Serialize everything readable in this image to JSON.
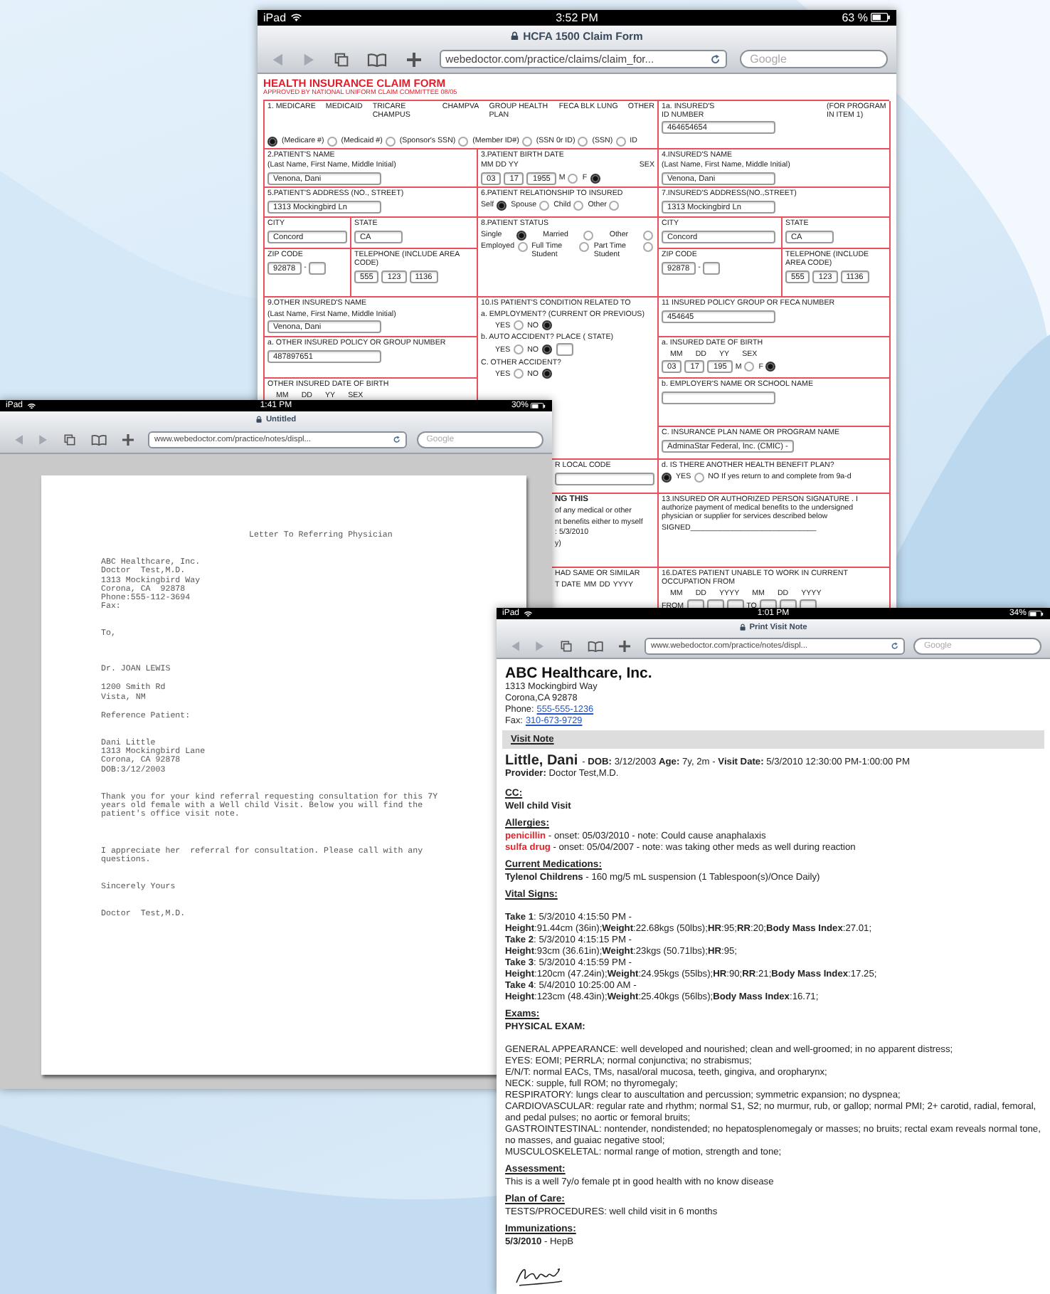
{
  "claim_window": {
    "status_bar": {
      "device": "iPad",
      "time": "3:52 PM",
      "battery": "63 %"
    },
    "title": "HCFA 1500 Claim Form",
    "url": "webedoctor.com/practice/claims/claim_for...",
    "search": {
      "placeholder": "Google"
    },
    "form": {
      "title": "HEALTH INSURANCE CLAIM FORM",
      "subtitle": "APPROVED BY NATIONAL UNIFORM CLAIM COMMITTEE 08/05",
      "cells": [
        {
          "lines": [
            {
              "kind": "spread",
              "parts": [
                {
                  "kind": "text",
                  "text": "1. MEDICARE"
                },
                {
                  "kind": "text",
                  "text": "MEDICAID"
                },
                {
                  "kind": "text",
                  "text": "TRICARE CHAMPUS"
                },
                {
                  "kind": "text",
                  "text": "CHAMPVA"
                },
                {
                  "kind": "text",
                  "text": "GROUP HEALTH PLAN"
                },
                {
                  "kind": "text",
                  "text": "FECA BLK LUNG"
                },
                {
                  "kind": "text",
                  "text": "OTHER"
                }
              ]
            },
            {
              "kind": "bottom",
              "parts": [
                {
                  "kind": "radio",
                  "selected": true
                },
                {
                  "kind": "text",
                  "text": "(Medicare #)"
                },
                {
                  "kind": "radio",
                  "selected": false
                },
                {
                  "kind": "text",
                  "text": "(Medicaid #)"
                },
                {
                  "kind": "radio",
                  "selected": false
                },
                {
                  "kind": "text",
                  "text": "(Sponsor's SSN)"
                },
                {
                  "kind": "radio",
                  "selected": false
                },
                {
                  "kind": "text",
                  "text": "(Member ID#)"
                },
                {
                  "kind": "radio",
                  "selected": false
                },
                {
                  "kind": "text",
                  "text": "(SSN 0r ID)"
                },
                {
                  "kind": "radio",
                  "selected": false
                },
                {
                  "kind": "text",
                  "text": "(SSN)"
                },
                {
                  "kind": "radio",
                  "selected": false
                },
                {
                  "kind": "text",
                  "text": "ID"
                }
              ]
            }
          ]
        },
        {
          "lines": [
            {
              "kind": "spread",
              "parts": [
                {
                  "kind": "text",
                  "text": "1a. INSURED'S ID NUMBER"
                },
                {
                  "kind": "text",
                  "text": "(FOR PROGRAM IN ITEM 1)"
                }
              ]
            },
            {
              "kind": "row",
              "parts": [
                {
                  "kind": "field",
                  "value": "464654654"
                }
              ]
            }
          ]
        },
        {
          "lines": [
            {
              "kind": "row",
              "parts": [
                {
                  "kind": "text",
                  "text": "2.PATIENT'S NAME"
                }
              ]
            },
            {
              "kind": "row",
              "parts": [
                {
                  "kind": "text",
                  "text": "(Last Name, First Name, Middle Initial)"
                }
              ]
            },
            {
              "kind": "row",
              "parts": [
                {
                  "kind": "field",
                  "value": "Venona, Dani"
                }
              ]
            }
          ]
        },
        {
          "lines": [
            {
              "kind": "row",
              "parts": [
                {
                  "kind": "text",
                  "text": "3.PATIENT BIRTH DATE"
                }
              ]
            },
            {
              "kind": "spread",
              "parts": [
                {
                  "kind": "text",
                  "text": "MM DD YY"
                },
                {
                  "kind": "text",
                  "text": "SEX"
                }
              ]
            },
            {
              "kind": "row",
              "parts": [
                {
                  "kind": "field",
                  "value": "03"
                },
                {
                  "kind": "field",
                  "value": "17"
                },
                {
                  "kind": "field",
                  "value": "1955"
                },
                {
                  "kind": "text",
                  "text": "M"
                },
                {
                  "kind": "radio",
                  "selected": false
                },
                {
                  "kind": "text",
                  "text": "F"
                },
                {
                  "kind": "radio",
                  "selected": true
                }
              ]
            }
          ]
        },
        {
          "lines": [
            {
              "kind": "row",
              "parts": [
                {
                  "kind": "text",
                  "text": "4.INSURED'S NAME"
                }
              ]
            },
            {
              "kind": "row",
              "parts": [
                {
                  "kind": "text",
                  "text": "(Last Name, First Name, Middle Initial)"
                }
              ]
            },
            {
              "kind": "row",
              "parts": [
                {
                  "kind": "field",
                  "value": "Venona, Dani"
                }
              ]
            }
          ]
        },
        {
          "lines": [
            {
              "kind": "row",
              "parts": [
                {
                  "kind": "text",
                  "text": "5.PATIENT'S ADDRESS (NO., STREET)"
                }
              ]
            },
            {
              "kind": "row",
              "parts": [
                {
                  "kind": "field",
                  "value": "1313 Mockingbird Ln"
                }
              ]
            }
          ]
        },
        {
          "lines": [
            {
              "kind": "row",
              "parts": [
                {
                  "kind": "text",
                  "text": "6.PATIENT RELATIONSHIP TO INSURED"
                }
              ]
            },
            {
              "kind": "row",
              "parts": [
                {
                  "kind": "text",
                  "text": "Self"
                },
                {
                  "kind": "radio",
                  "selected": true
                },
                {
                  "kind": "text",
                  "text": "Spouse"
                },
                {
                  "kind": "radio",
                  "selected": false
                },
                {
                  "kind": "text",
                  "text": "Child"
                },
                {
                  "kind": "radio",
                  "selected": false
                },
                {
                  "kind": "text",
                  "text": "Other"
                },
                {
                  "kind": "radio",
                  "selected": false
                }
              ]
            }
          ]
        },
        {
          "lines": [
            {
              "kind": "row",
              "parts": [
                {
                  "kind": "text",
                  "text": "7.INSURED'S ADDRESS(NO.,STREET)"
                }
              ]
            },
            {
              "kind": "row",
              "parts": [
                {
                  "kind": "field",
                  "value": "1313 Mockingbird Ln"
                }
              ]
            }
          ]
        },
        {
          "lines": [
            {
              "kind": "row",
              "parts": [
                {
                  "kind": "text",
                  "text": "CITY"
                }
              ]
            },
            {
              "kind": "row",
              "parts": [
                {
                  "kind": "field",
                  "value": "Concord"
                }
              ]
            }
          ]
        },
        {
          "lines": [
            {
              "kind": "row",
              "parts": [
                {
                  "kind": "text",
                  "text": "STATE"
                }
              ]
            },
            {
              "kind": "row",
              "parts": [
                {
                  "kind": "field",
                  "value": "CA"
                }
              ]
            }
          ]
        },
        {
          "lines": [
            {
              "kind": "row",
              "parts": [
                {
                  "kind": "text",
                  "text": "8.PATIENT STATUS"
                }
              ]
            },
            {
              "kind": "spread",
              "parts": [
                {
                  "kind": "text",
                  "text": "Single"
                },
                {
                  "kind": "radio",
                  "selected": true
                },
                {
                  "kind": "text",
                  "text": "Married"
                },
                {
                  "kind": "radio",
                  "selected": false
                },
                {
                  "kind": "text",
                  "text": "Other"
                },
                {
                  "kind": "radio",
                  "selected": false
                }
              ]
            },
            {
              "kind": "spread",
              "parts": [
                {
                  "kind": "text",
                  "text": "Employed"
                },
                {
                  "kind": "radio",
                  "selected": false
                },
                {
                  "kind": "text",
                  "text": "Full Time Student"
                },
                {
                  "kind": "radio",
                  "selected": false
                },
                {
                  "kind": "text",
                  "text": "Part Time Student"
                },
                {
                  "kind": "radio",
                  "selected": false
                }
              ]
            }
          ]
        },
        {
          "lines": [
            {
              "kind": "row",
              "parts": [
                {
                  "kind": "text",
                  "text": "CITY"
                }
              ]
            },
            {
              "kind": "row",
              "parts": [
                {
                  "kind": "field",
                  "value": "Concord"
                }
              ]
            }
          ]
        },
        {
          "lines": [
            {
              "kind": "row",
              "parts": [
                {
                  "kind": "text",
                  "text": "STATE"
                }
              ]
            },
            {
              "kind": "row",
              "parts": [
                {
                  "kind": "field",
                  "value": "CA"
                }
              ]
            }
          ]
        },
        {
          "lines": [
            {
              "kind": "row",
              "parts": [
                {
                  "kind": "text",
                  "text": "ZIP CODE"
                }
              ]
            },
            {
              "kind": "row",
              "parts": [
                {
                  "kind": "field",
                  "value": "92878"
                },
                {
                  "kind": "text",
                  "text": "-"
                },
                {
                  "kind": "field"
                }
              ]
            }
          ]
        },
        {
          "lines": [
            {
              "kind": "row",
              "parts": [
                {
                  "kind": "text",
                  "text": "TELEPHONE (INCLUDE AREA CODE)"
                }
              ]
            },
            {
              "kind": "row",
              "parts": [
                {
                  "kind": "field",
                  "value": "555"
                },
                {
                  "kind": "field",
                  "value": "123"
                },
                {
                  "kind": "field",
                  "value": "1136"
                }
              ]
            }
          ]
        },
        {
          "lines": [
            {
              "kind": "row",
              "parts": [
                {
                  "kind": "text",
                  "text": "ZIP CODE"
                }
              ]
            },
            {
              "kind": "row",
              "parts": [
                {
                  "kind": "field",
                  "value": "92878"
                },
                {
                  "kind": "text",
                  "text": "-"
                },
                {
                  "kind": "field"
                }
              ]
            }
          ]
        },
        {
          "lines": [
            {
              "kind": "row",
              "parts": [
                {
                  "kind": "text",
                  "text": "TELEPHONE (INCLUDE AREA CODE)"
                }
              ]
            },
            {
              "kind": "row",
              "parts": [
                {
                  "kind": "field",
                  "value": "555"
                },
                {
                  "kind": "field",
                  "value": "123"
                },
                {
                  "kind": "field",
                  "value": "1136"
                }
              ]
            }
          ]
        },
        {
          "lines": [
            {
              "kind": "row",
              "parts": [
                {
                  "kind": "text",
                  "text": "9.OTHER INSURED'S NAME"
                }
              ]
            },
            {
              "kind": "row",
              "parts": [
                {
                  "kind": "text",
                  "text": "(Last Name, First Name, Middle Initial)"
                }
              ]
            },
            {
              "kind": "row",
              "parts": [
                {
                  "kind": "field",
                  "value": "Venona, Dani"
                }
              ]
            }
          ]
        },
        {
          "lines": [
            {
              "kind": "row",
              "parts": [
                {
                  "kind": "text",
                  "text": "10.IS PATIENT'S CONDITION RELATED TO"
                }
              ]
            },
            {
              "kind": "row",
              "parts": [
                {
                  "kind": "text",
                  "text": "a. EMPLOYMENT? (CURRENT OR PREVIOUS)"
                }
              ]
            },
            {
              "kind": "indent",
              "parts": [
                {
                  "kind": "text",
                  "text": "YES"
                },
                {
                  "kind": "radio",
                  "selected": false
                },
                {
                  "kind": "text",
                  "text": "NO"
                },
                {
                  "kind": "radio",
                  "selected": true
                }
              ]
            },
            {
              "kind": "row",
              "parts": [
                {
                  "kind": "text",
                  "text": "b. AUTO ACCIDENT?  PLACE ( STATE)"
                }
              ]
            },
            {
              "kind": "indent",
              "parts": [
                {
                  "kind": "text",
                  "text": "YES"
                },
                {
                  "kind": "radio",
                  "selected": false
                },
                {
                  "kind": "text",
                  "text": "NO"
                },
                {
                  "kind": "radio",
                  "selected": true
                },
                {
                  "kind": "field"
                }
              ]
            },
            {
              "kind": "row",
              "parts": [
                {
                  "kind": "text",
                  "text": "C. OTHER ACCIDENT?"
                }
              ]
            },
            {
              "kind": "indent",
              "parts": [
                {
                  "kind": "text",
                  "text": "YES"
                },
                {
                  "kind": "radio",
                  "selected": false
                },
                {
                  "kind": "text",
                  "text": "NO"
                },
                {
                  "kind": "radio",
                  "selected": true
                }
              ]
            }
          ]
        },
        {
          "lines": [
            {
              "kind": "row",
              "parts": [
                {
                  "kind": "text",
                  "text": "11 INSURED POLICY GROUP OR FECA  NUMBER"
                }
              ]
            },
            {
              "kind": "row",
              "parts": [
                {
                  "kind": "field",
                  "value": "454645"
                }
              ]
            }
          ]
        },
        {
          "lines": [
            {
              "kind": "row",
              "parts": [
                {
                  "kind": "text",
                  "text": "a. OTHER INSURED POLICY OR GROUP NUMBER"
                }
              ]
            },
            {
              "kind": "row",
              "parts": [
                {
                  "kind": "field",
                  "value": "487897651"
                }
              ]
            }
          ]
        },
        {
          "lines": [
            {
              "kind": "row",
              "parts": [
                {
                  "kind": "text",
                  "text": "a. INSURED DATE OF BIRTH"
                }
              ]
            },
            {
              "kind": "wide",
              "parts": [
                {
                  "kind": "text",
                  "text": "MM"
                },
                {
                  "kind": "text",
                  "text": "DD"
                },
                {
                  "kind": "text",
                  "text": "YY"
                },
                {
                  "kind": "text",
                  "text": "SEX"
                }
              ]
            },
            {
              "kind": "row",
              "parts": [
                {
                  "kind": "field",
                  "value": "03"
                },
                {
                  "kind": "field",
                  "value": "17"
                },
                {
                  "kind": "field",
                  "value": "195"
                },
                {
                  "kind": "text",
                  "text": "M"
                },
                {
                  "kind": "radio",
                  "selected": false
                },
                {
                  "kind": "text",
                  "text": "F"
                },
                {
                  "kind": "radio",
                  "selected": true
                }
              ]
            }
          ]
        },
        {
          "lines": [
            {
              "kind": "row",
              "parts": [
                {
                  "kind": "text",
                  "text": "OTHER INSURED DATE OF BIRTH"
                }
              ]
            },
            {
              "kind": "wide",
              "parts": [
                {
                  "kind": "text",
                  "text": "MM"
                },
                {
                  "kind": "text",
                  "text": "DD"
                },
                {
                  "kind": "text",
                  "text": "YY"
                },
                {
                  "kind": "text",
                  "text": "SEX"
                }
              ]
            }
          ]
        },
        {
          "lines": [
            {
              "kind": "row",
              "parts": [
                {
                  "kind": "text",
                  "text": "b. EMPLOYER'S NAME OR SCHOOL NAME"
                }
              ]
            },
            {
              "kind": "row",
              "parts": [
                {
                  "kind": "field"
                }
              ]
            }
          ]
        },
        {
          "lines": [
            {
              "kind": "row",
              "parts": [
                {
                  "kind": "text",
                  "text": "C. INSURANCE PLAN NAME OR PROGRAM NAME"
                }
              ]
            },
            {
              "kind": "row",
              "parts": [
                {
                  "kind": "field",
                  "value": "AdminaStar Federal, Inc. (CMIC) -"
                }
              ]
            }
          ]
        },
        {
          "lines": [
            {
              "kind": "row",
              "parts": [
                {
                  "kind": "text",
                  "text": "R LOCAL CODE"
                }
              ]
            },
            {
              "kind": "row",
              "parts": [
                {
                  "kind": "field"
                }
              ]
            }
          ]
        },
        {
          "lines": [
            {
              "kind": "row",
              "parts": [
                {
                  "kind": "text",
                  "text": "d. IS THERE ANOTHER HEALTH BENEFIT PLAN?"
                }
              ]
            },
            {
              "kind": "row",
              "parts": [
                {
                  "kind": "radio",
                  "selected": true
                },
                {
                  "kind": "text",
                  "text": "YES"
                },
                {
                  "kind": "radio",
                  "selected": false
                },
                {
                  "kind": "text",
                  "text": "NO If yes return to and complete from 9a-d"
                }
              ]
            }
          ]
        },
        {
          "lines": [
            {
              "kind": "row",
              "parts": [
                {
                  "kind": "bold",
                  "text": "NG THIS"
                }
              ]
            },
            {
              "kind": "row",
              "parts": [
                {
                  "kind": "text",
                  "text": "of any medical or other"
                }
              ]
            },
            {
              "kind": "row",
              "parts": [
                {
                  "kind": "text",
                  "text": "nt benefits either to myself"
                }
              ]
            },
            {
              "kind": "row",
              "parts": [
                {
                  "kind": "text",
                  "text": ": 5/3/2010"
                }
              ]
            },
            {
              "kind": "row",
              "parts": [
                {
                  "kind": "text",
                  "text": "y)"
                }
              ]
            }
          ]
        },
        {
          "lines": [
            {
              "kind": "row",
              "parts": [
                {
                  "kind": "text",
                  "text": "13.INSURED OR AUTHORIZED PERSON SIGNATURE . I authorize payment of medical benefits to the undersigned physician or supplier for services described below"
                }
              ]
            },
            {
              "kind": "row",
              "parts": [
                {
                  "kind": "text",
                  "text": "SIGNED______________________________"
                }
              ]
            }
          ]
        },
        {
          "lines": [
            {
              "kind": "row",
              "parts": [
                {
                  "kind": "text",
                  "text": "HAD SAME OR SIMILAR"
                }
              ]
            },
            {
              "kind": "row",
              "parts": [
                {
                  "kind": "text",
                  "text": "T DATE"
                },
                {
                  "kind": "text",
                  "text": "MM"
                },
                {
                  "kind": "text",
                  "text": "DD"
                },
                {
                  "kind": "text",
                  "text": "YYYY"
                }
              ]
            }
          ]
        },
        {
          "lines": [
            {
              "kind": "row",
              "parts": [
                {
                  "kind": "text",
                  "text": "16.DATES PATIENT UNABLE TO WORK IN CURRENT OCCUPATION FROM"
                }
              ]
            },
            {
              "kind": "wide",
              "parts": [
                {
                  "kind": "text",
                  "text": "MM"
                },
                {
                  "kind": "text",
                  "text": "DD"
                },
                {
                  "kind": "text",
                  "text": "YYYY"
                },
                {
                  "kind": "text",
                  "text": "MM"
                },
                {
                  "kind": "text",
                  "text": "DD"
                },
                {
                  "kind": "text",
                  "text": "YYYY"
                }
              ]
            },
            {
              "kind": "row",
              "parts": [
                {
                  "kind": "text",
                  "text": "FROM"
                },
                {
                  "kind": "field"
                },
                {
                  "kind": "field"
                },
                {
                  "kind": "field"
                },
                {
                  "kind": "text",
                  "text": "TO"
                },
                {
                  "kind": "field"
                },
                {
                  "kind": "field"
                },
                {
                  "kind": "field"
                }
              ]
            }
          ]
        }
      ]
    }
  },
  "letter_window": {
    "status_bar": {
      "device": "iPad",
      "time": "1:41 PM",
      "battery": "30%"
    },
    "title": "Untitled",
    "url": "www.webedoctor.com/practice/notes/displ...",
    "search": {
      "placeholder": "Google"
    },
    "letter": {
      "title": "Letter To Referring Physician",
      "blocks": [
        {
          "kind": "lines",
          "lines": [
            "ABC Healthcare, Inc.",
            "Doctor  Test,M.D.",
            "1313 Mockingbird Way",
            "Corona, CA  92878",
            "Phone:555-112-3694",
            "Fax:"
          ]
        },
        {
          "kind": "lines",
          "lines": [
            "To,"
          ]
        },
        {
          "kind": "lines",
          "lines": [
            "Dr. JOAN LEWIS"
          ]
        },
        {
          "kind": "lines",
          "lines": [
            "1200 Smith Rd",
            "Vista, NM"
          ]
        },
        {
          "kind": "lines",
          "lines": [
            "Reference Patient:"
          ]
        },
        {
          "kind": "lines",
          "lines": [
            "Dani Little",
            "1313 Mockingbird Lane",
            "Corona, CA 92878",
            "DOB:3/12/2003"
          ]
        },
        {
          "kind": "paragraph",
          "text": "Thank you for your kind referral requesting consultation for this 7Y years old female with a Well child Visit. Below you will find the patient's office visit note."
        },
        {
          "kind": "paragraph",
          "text": "I appreciate her  referral for consultation. Please call with any questions."
        },
        {
          "kind": "lines",
          "lines": [
            "Sincerely Yours"
          ]
        },
        {
          "kind": "lines",
          "lines": [
            "Doctor  Test,M.D."
          ]
        }
      ]
    }
  },
  "visit_note_window": {
    "status_bar": {
      "device": "iPad",
      "time": "1:01 PM",
      "battery": "34%"
    },
    "title": "Print Visit Note",
    "url": "www.webedoctor.com/practice/notes/displ...",
    "search": {
      "placeholder": "Google"
    },
    "note": {
      "company": "ABC Healthcare, Inc.",
      "address": [
        "1313 Mockingbird Way",
        "Corona,CA 92878"
      ],
      "phone": {
        "label": "Phone:",
        "number": "555-555-1236"
      },
      "fax": {
        "label": "Fax:",
        "number": "310-673-9729"
      },
      "section_bar": "Visit Note",
      "patient_name": "Little, Dani",
      "visit_details": "- **DOB:** 3/12/2003 **Age:** 7y, 2m - **Visit Date:** 5/3/2010 12:30:00 PM-1:00:00 PM",
      "provider": "**Provider:** Doctor Test,M.D.",
      "sections": [
        {
          "heading": "CC:",
          "lines": [
            {
              "kind": "bold",
              "text": "Well child Visit"
            }
          ]
        },
        {
          "heading": "Allergies:",
          "lines": [
            {
              "kind": "allergy",
              "name": "penicillin",
              "text": " - onset: 05/03/2010 - note: Could cause anaphalaxis"
            },
            {
              "kind": "allergy",
              "name": "sulfa drug",
              "text": " - onset: 05/04/2007 - note: was taking other meds as well during reaction"
            }
          ]
        },
        {
          "heading": "Current Medications:",
          "lines": [
            {
              "kind": "rich",
              "text": "**Tylenol Childrens** - 160 mg/5 mL suspension (1 Tablespoon(s)/Once Daily)"
            }
          ]
        },
        {
          "heading": "Vital Signs:",
          "lines": [
            {
              "kind": "vital",
              "text": "**Take 1**: 5/3/2010 4:15:50 PM -"
            },
            {
              "kind": "vital",
              "text": "**Height**:91.44cm (36in);**Weight**:22.68kgs (50lbs);**HR**:95;**RR**:20;**Body Mass Index**:27.01;"
            },
            {
              "kind": "vital",
              "text": "**Take 2**: 5/3/2010 4:15:15 PM -"
            },
            {
              "kind": "vital",
              "text": "**Height**:93cm (36.61in);**Weight**:23kgs (50.71lbs);**HR**:95;"
            },
            {
              "kind": "vital",
              "text": "**Take 3**: 5/3/2010 4:15:59 PM -"
            },
            {
              "kind": "vital",
              "text": "**Height**:120cm (47.24in);**Weight**:24.95kgs (55lbs);**HR**:90;**RR**:21;**Body Mass Index**:17.25;"
            },
            {
              "kind": "vital",
              "text": "**Take 4**: 5/4/2010 10:25:00 AM -"
            },
            {
              "kind": "vital",
              "text": "**Height**:123cm (48.43in);**Weight**:25.40kgs (56lbs);**Body Mass Index**:16.71;"
            }
          ]
        },
        {
          "heading": "Exams:",
          "lines": [
            {
              "kind": "subhead",
              "text": "PHYSICAL EXAM:"
            },
            {
              "kind": "rich",
              "text": "GENERAL APPEARANCE: well developed and nourished; clean and well-groomed; in no apparent distress;"
            },
            {
              "kind": "rich",
              "text": "EYES: EOMI; PERRLA; normal conjunctiva; no strabismus;"
            },
            {
              "kind": "rich",
              "text": "E/N/T: normal EACs, TMs, nasal/oral mucosa, teeth, gingiva, and oropharynx;"
            },
            {
              "kind": "rich",
              "text": "NECK: supple, full ROM; no thyromegaly;"
            },
            {
              "kind": "rich",
              "text": "RESPIRATORY: lungs clear to auscultation and percussion; symmetric expansion; no dyspnea;"
            },
            {
              "kind": "rich",
              "text": "CARDIOVASCULAR: regular rate and rhythm; normal S1, S2; no murmur, rub, or gallop; normal PMI; 2+ carotid, radial, femoral, and pedal pulses; no aortic or femoral bruits;"
            },
            {
              "kind": "rich",
              "text": "GASTROINTESTINAL: nontender, nondistended; no hepatosplenomegaly or masses; no bruits; rectal exam reveals normal tone, no masses, and guaiac negative stool;"
            },
            {
              "kind": "rich",
              "text": "MUSCULOSKELETAL: normal range of motion, strength and tone;"
            }
          ]
        },
        {
          "heading": "Assessment:",
          "lines": [
            {
              "kind": "rich",
              "text": "This is a well 7y/o female pt in good health with no know disease"
            }
          ]
        },
        {
          "heading": "Plan of Care:",
          "lines": [
            {
              "kind": "rich",
              "text": "TESTS/PROCEDURES: well child visit in 6 months"
            }
          ]
        },
        {
          "heading": "Immunizations:",
          "lines": [
            {
              "kind": "rich",
              "text": "**5/3/2010** - HepB"
            }
          ]
        }
      ]
    }
  }
}
